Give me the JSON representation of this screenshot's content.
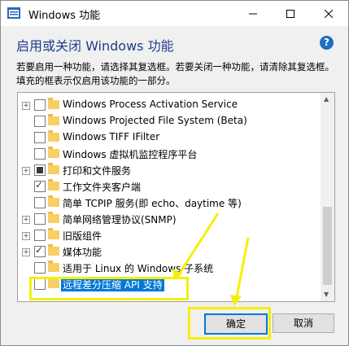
{
  "window": {
    "title": "Windows 功能",
    "heading": "启用或关闭 Windows 功能",
    "description": "若要启用一种功能，请选择其复选框。若要关闭一种功能，请清除其复选框。填充的框表示仅启用该功能的一部分。",
    "help_icon": "?"
  },
  "titlebar_buttons": {
    "minimize": "minimize-icon",
    "maximize": "maximize-icon",
    "close": "close-icon"
  },
  "features": [
    {
      "label": "Windows Process Activation Service",
      "expandable": true,
      "state": "unchecked"
    },
    {
      "label": "Windows Projected File System (Beta)",
      "expandable": false,
      "state": "unchecked"
    },
    {
      "label": "Windows TIFF IFilter",
      "expandable": false,
      "state": "unchecked"
    },
    {
      "label": "Windows 虚拟机监控程序平台",
      "expandable": false,
      "state": "unchecked"
    },
    {
      "label": "打印和文件服务",
      "expandable": true,
      "state": "partial"
    },
    {
      "label": "工作文件夹客户端",
      "expandable": false,
      "state": "checked"
    },
    {
      "label": "简单 TCPIP 服务(即 echo、daytime 等)",
      "expandable": false,
      "state": "unchecked"
    },
    {
      "label": "简单网络管理协议(SNMP)",
      "expandable": true,
      "state": "unchecked"
    },
    {
      "label": "旧版组件",
      "expandable": true,
      "state": "unchecked"
    },
    {
      "label": "媒体功能",
      "expandable": true,
      "state": "checked"
    },
    {
      "label": "适用于 Linux 的 Windows 子系统",
      "expandable": false,
      "state": "unchecked"
    },
    {
      "label": "远程差分压缩 API 支持",
      "expandable": false,
      "state": "unchecked",
      "selected": true
    }
  ],
  "buttons": {
    "ok": "确定",
    "cancel": "取消"
  },
  "annotation_color": "#f5ef0a"
}
